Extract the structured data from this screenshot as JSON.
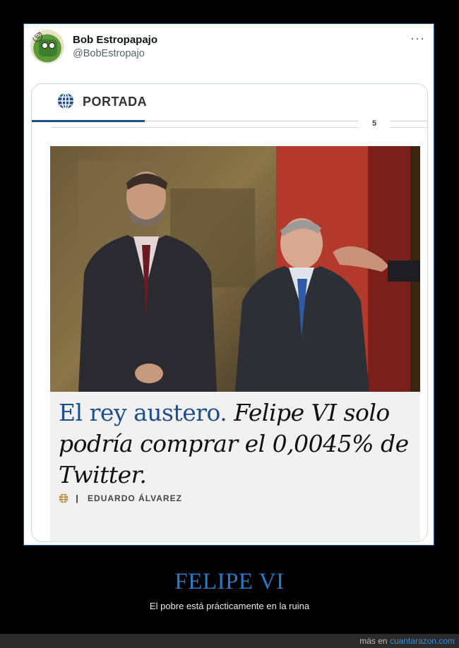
{
  "tweet": {
    "user_name": "Bob Estropapajo",
    "user_handle": "@BobEstropajo",
    "more_label": "···"
  },
  "newspaper": {
    "section_label": "PORTADA",
    "page_number": "5",
    "headline_lead": "El rey austero.",
    "headline_rest": "Felipe VI solo podría comprar el 0,0045% de Twitter.",
    "byline_separator": "|",
    "author": "EDUARDO ÁLVAREZ",
    "accent_color": "#1f4e8c"
  },
  "caption": {
    "title": "FELIPE VI",
    "subtitle": "El pobre está prácticamente en la ruina"
  },
  "footer": {
    "prefix": "más en",
    "link": "cuantarazon.com"
  }
}
